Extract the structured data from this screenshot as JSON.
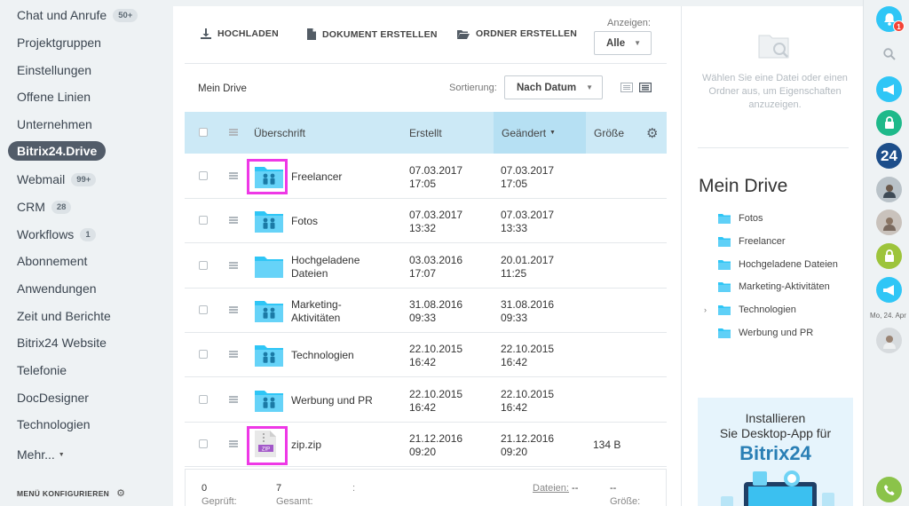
{
  "sidebar": {
    "items": [
      {
        "label": "Chat und Anrufe",
        "badge": "50+"
      },
      {
        "label": "Projektgruppen",
        "badge": ""
      },
      {
        "label": "Einstellungen",
        "badge": ""
      },
      {
        "label": "Offene Linien",
        "badge": ""
      },
      {
        "label": "Unternehmen",
        "badge": ""
      },
      {
        "label": "Bitrix24.Drive",
        "badge": ""
      },
      {
        "label": "Webmail",
        "badge": "99+"
      },
      {
        "label": "CRM",
        "badge": "28"
      },
      {
        "label": "Workflows",
        "badge": "1"
      },
      {
        "label": "Abonnement",
        "badge": ""
      },
      {
        "label": "Anwendungen",
        "badge": ""
      },
      {
        "label": "Zeit und Berichte",
        "badge": ""
      },
      {
        "label": "Bitrix24 Website",
        "badge": ""
      },
      {
        "label": "Telefonie",
        "badge": ""
      },
      {
        "label": "DocDesigner",
        "badge": ""
      },
      {
        "label": "Technologien",
        "badge": ""
      },
      {
        "label": "Mehr...",
        "badge": ""
      }
    ],
    "active_index": 5,
    "menu_config": "MENÜ KONFIGURIEREN"
  },
  "toolbar": {
    "upload": "HOCHLADEN",
    "create_doc": "DOKUMENT ERSTELLEN",
    "create_folder": "ORDNER ERSTELLEN",
    "show_label": "Anzeigen:",
    "show_value": "Alle"
  },
  "drive": {
    "title": "Mein Drive",
    "sort_label": "Sortierung:",
    "sort_value": "Nach Datum"
  },
  "table": {
    "headers": {
      "title": "Überschrift",
      "created": "Erstellt",
      "changed": "Geändert",
      "size": "Größe"
    },
    "rows": [
      {
        "name": "Freelancer",
        "created_d": "07.03.2017",
        "created_t": "17:05",
        "changed_d": "07.03.2017",
        "changed_t": "17:05",
        "size": "",
        "icon": "shared-folder-icon"
      },
      {
        "name": "Fotos",
        "created_d": "07.03.2017",
        "created_t": "13:32",
        "changed_d": "07.03.2017",
        "changed_t": "13:33",
        "size": "",
        "icon": "shared-folder-icon"
      },
      {
        "name": "Hochgeladene Dateien",
        "created_d": "03.03.2016",
        "created_t": "17:07",
        "changed_d": "20.01.2017",
        "changed_t": "11:25",
        "size": "",
        "icon": "folder-icon"
      },
      {
        "name": "Marketing-Aktivitäten",
        "created_d": "31.08.2016",
        "created_t": "09:33",
        "changed_d": "31.08.2016",
        "changed_t": "09:33",
        "size": "",
        "icon": "shared-folder-icon"
      },
      {
        "name": "Technologien",
        "created_d": "22.10.2015",
        "created_t": "16:42",
        "changed_d": "22.10.2015",
        "changed_t": "16:42",
        "size": "",
        "icon": "shared-folder-icon"
      },
      {
        "name": "Werbung und PR",
        "created_d": "22.10.2015",
        "created_t": "16:42",
        "changed_d": "22.10.2015",
        "changed_t": "16:42",
        "size": "",
        "icon": "shared-folder-icon"
      },
      {
        "name": "zip.zip",
        "created_d": "21.12.2016",
        "created_t": "09:20",
        "changed_d": "21.12.2016",
        "changed_t": "09:20",
        "size": "134 B",
        "icon": "zip-file-icon"
      }
    ]
  },
  "footer": {
    "checked_label": "Geprüft:",
    "checked_value": "0",
    "total_label": "Gesamt:",
    "total_value": "7",
    "colon": ":",
    "files_label": "Dateien:",
    "files_value": "--",
    "size_label": "Größe:",
    "size_value": "--"
  },
  "props": {
    "hint": "Wählen Sie eine Datei oder einen Ordner aus, um Eigenschaften anzuzeigen.",
    "title": "Mein Drive",
    "tree": [
      "Fotos",
      "Freelancer",
      "Hochgeladene Dateien",
      "Marketing-Aktivitäten",
      "Technologien",
      "Werbung und PR"
    ],
    "ad_line1": "Installieren",
    "ad_line2": "Sie Desktop-App für",
    "ad_line3": "Bitrix24"
  },
  "rightbar": {
    "notif_count": "1",
    "date": "Mo, 24. Apr",
    "badge_24": "24"
  },
  "colors": {
    "accent": "#2fc6f6",
    "header_bg": "#cce9f6",
    "highlight": "#ee38e6",
    "active_nav": "#525c69"
  }
}
